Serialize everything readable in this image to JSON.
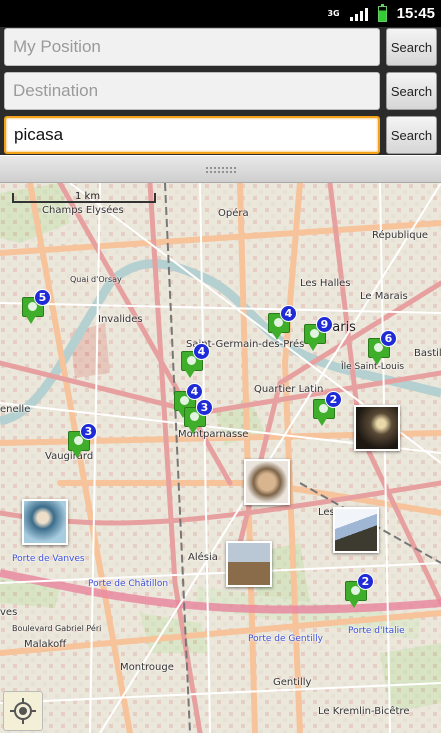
{
  "status_bar": {
    "time": "15:45",
    "network": "3G"
  },
  "search_panel": {
    "my_position": {
      "placeholder": "My Position",
      "value": ""
    },
    "destination": {
      "placeholder": "Destination",
      "value": ""
    },
    "query": {
      "placeholder": "",
      "value": "picasa"
    },
    "button_label": "Search"
  },
  "map": {
    "scale_label": "1 km",
    "labels": {
      "champs": "Champs Elysées",
      "opera": "Opéra",
      "republique": "République",
      "quai": "Quai d'Orsay",
      "les_halles": "Les Halles",
      "le_marais": "Le Marais",
      "invalides": "Invalides",
      "paris": "Paris",
      "saint_germain": "Saint-Germain-des-Prés",
      "saint_louis": "Île Saint-Louis",
      "bastille": "Bastil",
      "grenelle": "enelle",
      "quartier_latin": "Quartier Latin",
      "montparnasse": "Montparnasse",
      "vaugirard": "Vaugirard",
      "les": "Les",
      "alesia": "Alésia",
      "porte_vanves": "Porte de Vanves",
      "porte_chatillon": "Porte de Châtillon",
      "ves": "ves",
      "boulevard": "Boulevard Gabriel Péri",
      "malakoff": "Malakoff",
      "porte_gentilly": "Porte de Gentilly",
      "porte_italie": "Porte d'Italie",
      "montrouge": "Montrouge",
      "gentilly": "Gentilly",
      "kremlin": "Le Kremlin-Bicêtre"
    },
    "markers": [
      {
        "count": "5"
      },
      {
        "count": "4"
      },
      {
        "count": "9"
      },
      {
        "count": "6"
      },
      {
        "count": "4"
      },
      {
        "count": "4"
      },
      {
        "count": "3"
      },
      {
        "count": "2"
      },
      {
        "count": "3"
      },
      {
        "count": "2"
      }
    ],
    "colors": {
      "marker_green": "#3fae2a",
      "marker_badge": "#1e2bd6",
      "focus": "#f3a21b"
    }
  }
}
